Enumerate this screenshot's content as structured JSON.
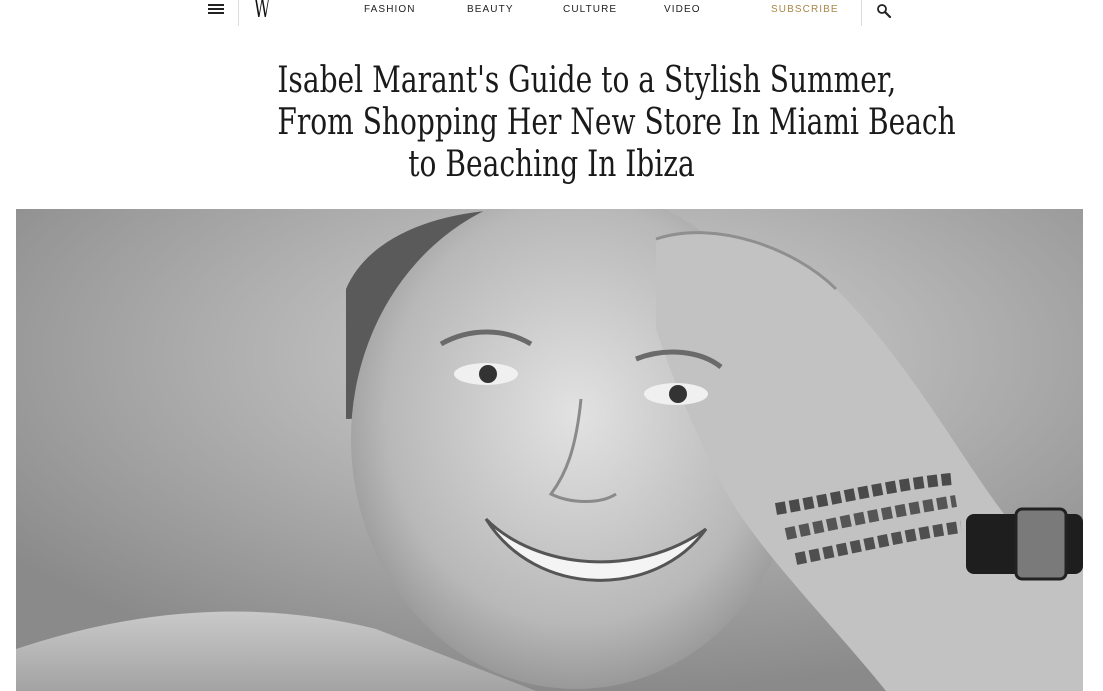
{
  "nav": {
    "logo": "W",
    "links": [
      {
        "label": "FASHION"
      },
      {
        "label": "BEAUTY"
      },
      {
        "label": "CULTURE"
      },
      {
        "label": "VIDEO"
      }
    ],
    "subscribe_label": "SUBSCRIBE",
    "accent_color": "#a8874a",
    "menu_icon": "hamburger-menu-icon",
    "search_icon": "search-icon"
  },
  "article": {
    "headline_lines": [
      "Isabel Marant's Guide to a Stylish Summer,",
      "From Shopping Her New Store In Miami Beach",
      "to Beaching In Ibiza"
    ]
  },
  "hero": {
    "style": "black-and-white portrait photograph"
  }
}
